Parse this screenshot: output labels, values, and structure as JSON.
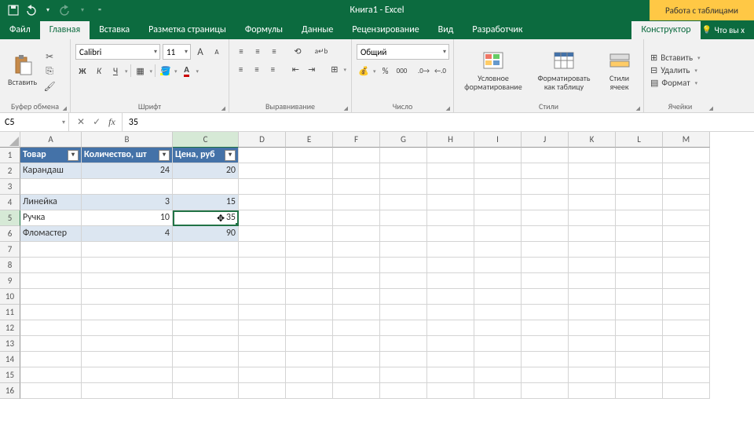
{
  "app": {
    "title": "Книга1  -  Excel",
    "table_tools": "Работа с таблицами"
  },
  "qat": {
    "save": "save-icon",
    "undo": "undo-icon",
    "redo": "redo-icon"
  },
  "tabs": {
    "file": "Файл",
    "home": "Главная",
    "insert": "Вставка",
    "layout": "Разметка страницы",
    "formulas": "Формулы",
    "data": "Данные",
    "review": "Рецензирование",
    "view": "Вид",
    "developer": "Разработчик",
    "design": "Конструктор",
    "tellme": "Что вы х"
  },
  "ribbon": {
    "clipboard": {
      "label": "Буфер обмена",
      "paste": "Вставить"
    },
    "font": {
      "label": "Шрифт",
      "name": "Calibri",
      "size": "11",
      "bold": "Ж",
      "italic": "К",
      "underline": "Ч"
    },
    "alignment": {
      "label": "Выравнивание",
      "wrap": "ab"
    },
    "number": {
      "label": "Число",
      "format": "Общий",
      "percent": "%",
      "comma": "000"
    },
    "styles": {
      "label": "Стили",
      "cond": "Условное форматирование",
      "astable": "Форматировать как таблицу",
      "cellstyles": "Стили ячеек"
    },
    "cells": {
      "label": "Ячейки",
      "insert": "Вставить",
      "delete": "Удалить",
      "format": "Формат"
    }
  },
  "fbar": {
    "name": "C5",
    "cancel": "✕",
    "enter": "✓",
    "fx": "fx",
    "formula": "35"
  },
  "columns": [
    "A",
    "B",
    "C",
    "D",
    "E",
    "F",
    "G",
    "H",
    "I",
    "J",
    "K",
    "L",
    "M"
  ],
  "headers": {
    "a": "Товар",
    "b": "Количество, шт",
    "c": "Цена, руб"
  },
  "data_rows": [
    {
      "a": "Карандаш",
      "b": "24",
      "c": "20",
      "band": true
    },
    {
      "a": "",
      "b": "",
      "c": "",
      "band": false
    },
    {
      "a": "Линейка",
      "b": "3",
      "c": "15",
      "band": true
    },
    {
      "a": "Ручка",
      "b": "10",
      "c": "35",
      "band": false,
      "active_c": true
    },
    {
      "a": "Фломастер",
      "b": "4",
      "c": "90",
      "band": true
    }
  ],
  "active": {
    "row": 5,
    "col": "C"
  },
  "colors": {
    "brand": "#0c6b3f",
    "select": "#217346",
    "header_blue": "#4472a8",
    "band": "#dce6f1"
  }
}
